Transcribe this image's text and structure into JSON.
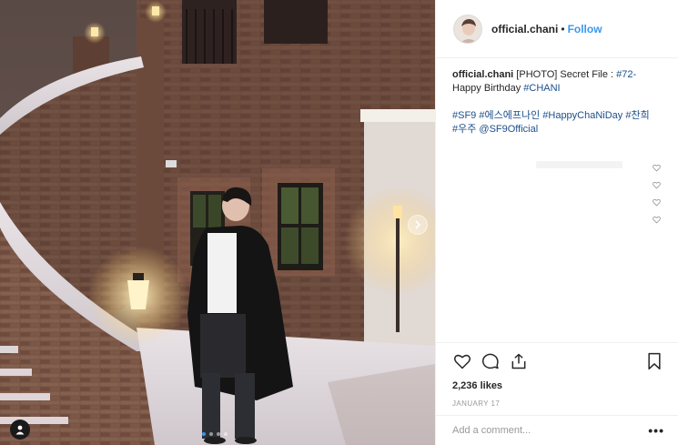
{
  "post": {
    "image_alt": "Person in a long black coat standing on snow in front of a brick building with a curved staircase and lit lamps at dusk"
  },
  "header": {
    "username": "official.chani",
    "separator": "•",
    "follow_label": "Follow"
  },
  "caption": {
    "username": "official.chani",
    "text_before": " [PHOTO] Secret File : ",
    "tag_72": "#72-",
    "text_line2": "Happy Birthday ",
    "tag_chani": "#CHANI",
    "tag_sf9": "#SF9",
    "tag_korean": " #에스에프나인",
    "tag_happy": " #HappyChaNiDay",
    "tag_chanhee": " #찬희",
    "tag_uju": "#우주",
    "mention": " @SF9Official"
  },
  "actions": {
    "likes": "2,236 likes",
    "date": "JANUARY 17"
  },
  "comment_bar": {
    "placeholder": "Add a comment...",
    "more_label": "•••"
  },
  "colors": {
    "link_blue": "#3897f0",
    "hashtag": "#1c4f8a",
    "border": "#efefef"
  },
  "icons": [
    "heart-icon",
    "comment-icon",
    "share-icon",
    "bookmark-icon",
    "next-arrow-icon",
    "user-tag-icon"
  ]
}
